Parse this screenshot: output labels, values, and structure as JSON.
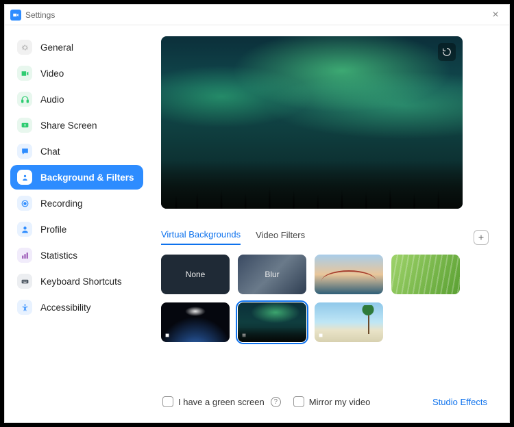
{
  "window": {
    "title": "Settings"
  },
  "sidebar": {
    "items": [
      {
        "label": "General"
      },
      {
        "label": "Video"
      },
      {
        "label": "Audio"
      },
      {
        "label": "Share Screen"
      },
      {
        "label": "Chat"
      },
      {
        "label": "Background & Filters"
      },
      {
        "label": "Recording"
      },
      {
        "label": "Profile"
      },
      {
        "label": "Statistics"
      },
      {
        "label": "Keyboard Shortcuts"
      },
      {
        "label": "Accessibility"
      }
    ]
  },
  "tabs": {
    "virtual_backgrounds": "Virtual Backgrounds",
    "video_filters": "Video Filters"
  },
  "thumbs": {
    "none": "None",
    "blur": "Blur"
  },
  "footer": {
    "green_screen": "I have a green screen",
    "mirror": "Mirror my video",
    "studio": "Studio Effects"
  }
}
